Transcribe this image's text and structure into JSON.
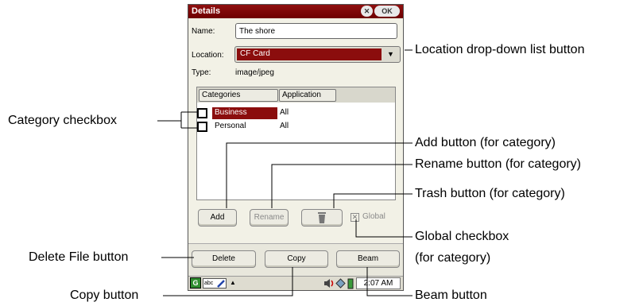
{
  "dialog": {
    "title": "Details",
    "close_glyph": "✕",
    "ok_label": "OK",
    "name_label": "Name:",
    "name_value": "The shore",
    "location_label": "Location:",
    "location_value": "CF Card",
    "location_arrow_glyph": "▼",
    "type_label": "Type:",
    "type_value": "image/jpeg",
    "columns": [
      "Categories",
      "Application"
    ],
    "categories": [
      {
        "name": "Business",
        "app": "All",
        "selected": true
      },
      {
        "name": "Personal",
        "app": "All",
        "selected": false
      }
    ],
    "buttons": {
      "add": "Add",
      "rename": "Rename",
      "global": "Global",
      "global_check_glyph": "✕",
      "delete": "Delete",
      "copy": "Copy",
      "beam": "Beam"
    },
    "taskbar": {
      "launcher_glyph": "G",
      "input_method": "abc",
      "up_arrow": "▲",
      "time": "2:07 AM"
    }
  },
  "callouts": {
    "location": "Location drop-down list button",
    "category_checkbox": "Category checkbox",
    "add": "Add button (for category)",
    "rename": "Rename button (for category)",
    "trash": "Trash button (for category)",
    "global_line1": "Global checkbox",
    "global_line2": "(for category)",
    "delete": "Delete File button",
    "copy": "Copy button",
    "beam": "Beam button"
  },
  "colors": {
    "titlebar": "#7a0505",
    "selection": "#8b0d0d",
    "dialog_bg": "#f2f1e6"
  }
}
